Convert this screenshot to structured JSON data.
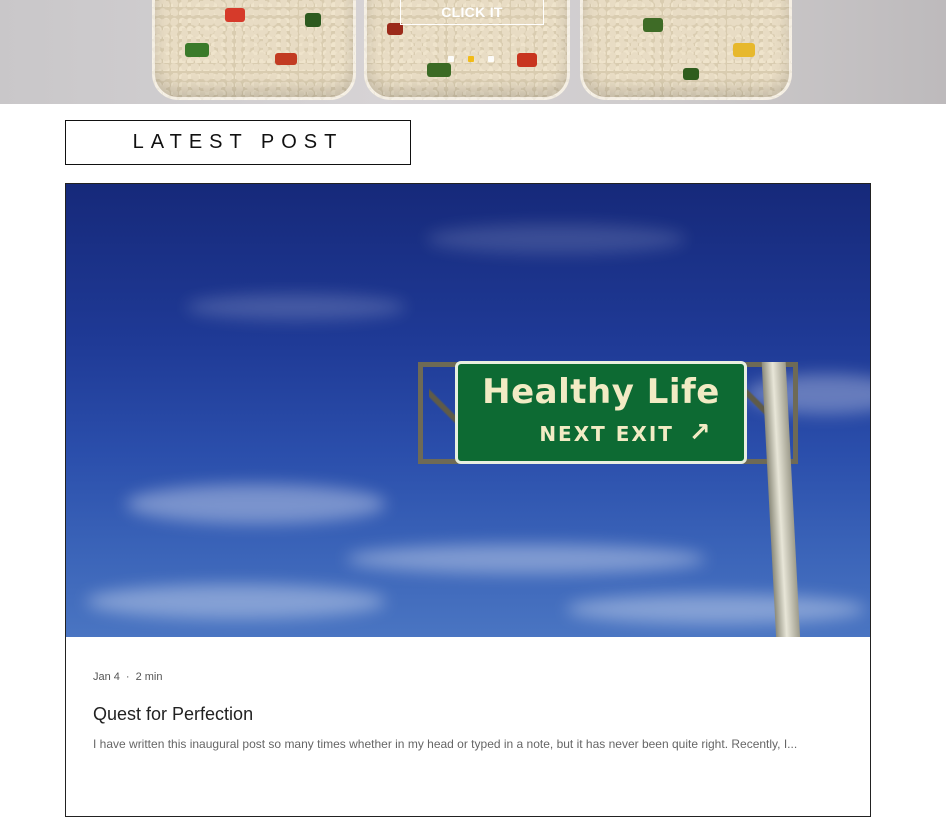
{
  "hero": {
    "cta_label": "CLICK IT",
    "slides": 3,
    "active_slide": 2,
    "accent": "#f2b705"
  },
  "section": {
    "title": "LATEST POST"
  },
  "post": {
    "cover_sign": {
      "line1": "Healthy Life",
      "line2": "NEXT EXIT",
      "arrow": "↗"
    },
    "date": "Jan 4",
    "separator": "·",
    "read_time": "2 min",
    "title": "Quest for Perfection",
    "excerpt": "I have written this inaugural post so many times whether in my head or typed in a note, but it has never been quite right. Recently, I..."
  },
  "colors": {
    "sign_green": "#0d6a33",
    "sky_blue": "#1f3a96"
  }
}
